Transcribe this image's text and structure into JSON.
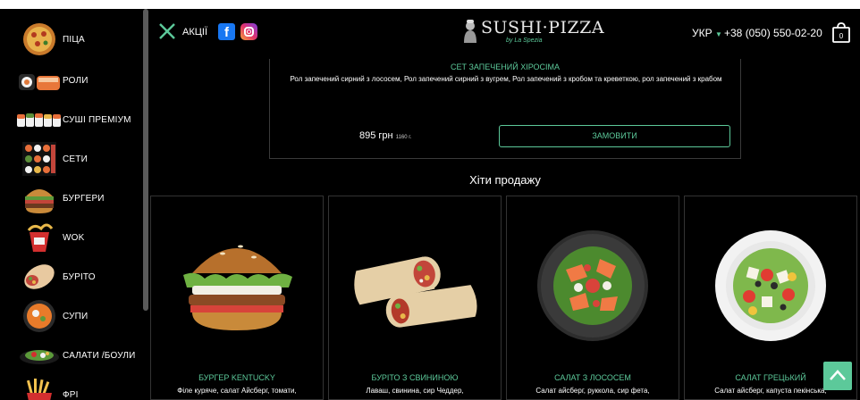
{
  "sidebar": {
    "items": [
      {
        "label": "Піца",
        "icon": "pizza-icon"
      },
      {
        "label": "Роли",
        "icon": "rolls-icon"
      },
      {
        "label": "Суші преміум",
        "icon": "sushi-premium-icon"
      },
      {
        "label": "Сети",
        "icon": "sets-icon"
      },
      {
        "label": "Бургери",
        "icon": "burger-icon"
      },
      {
        "label": "WOK",
        "icon": "wok-icon"
      },
      {
        "label": "Буріто",
        "icon": "burrito-icon"
      },
      {
        "label": "Супи",
        "icon": "soup-icon"
      },
      {
        "label": "Салати /Боули",
        "icon": "salad-icon"
      },
      {
        "label": "Фрі",
        "icon": "fries-icon"
      }
    ]
  },
  "header": {
    "promo_label": "Акції",
    "logo_text": "SUSHI·PIZZA",
    "logo_sub": "by La Spezia",
    "language": "УКР",
    "phone": "+38 (050) 550-02-20",
    "cart_count": "0"
  },
  "set_card": {
    "title": "Сет запечений Хіросіма",
    "description": "Рол запечений сирний з лососем, Рол запечений сирний з вугрем, Рол запечений з кробом та креветкою, рол запечений з крабом",
    "price": "895 грн",
    "weight": "1160 г.",
    "order_label": "Замовити"
  },
  "hits_title": "Хіти продажу",
  "products": [
    {
      "name": "Бургер Kentucky",
      "desc": "Філе куряче, салат Айсберг, томати,"
    },
    {
      "name": "Буріто з свининою",
      "desc": "Лаваш, свинина, сир Чеддер,"
    },
    {
      "name": "Салат з лососем",
      "desc": "Салат айсберг, руккола, сир фета,"
    },
    {
      "name": "Салат грецький",
      "desc": "Салат айсберг, капуста пекінська,"
    }
  ],
  "colors": {
    "accent": "#5cc99a",
    "background": "#000000"
  }
}
